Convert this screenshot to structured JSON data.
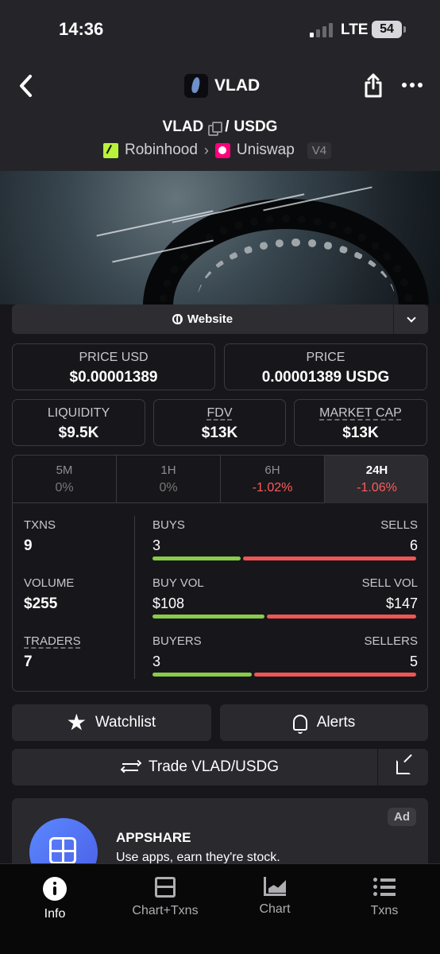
{
  "status_bar": {
    "time": "14:36",
    "network": "LTE",
    "battery": "54"
  },
  "header": {
    "token_name": "VLAD",
    "base": "VLAD",
    "separator": "/",
    "quote": "USDG",
    "chain": "Robinhood",
    "dex": "Uniswap",
    "version": "V4"
  },
  "website_button": "Website",
  "prices": [
    {
      "label": "PRICE USD",
      "value": "$0.00001389"
    },
    {
      "label": "PRICE",
      "value": "0.00001389 USDG"
    }
  ],
  "market_stats": [
    {
      "label": "LIQUIDITY",
      "value": "$9.5K"
    },
    {
      "label": "FDV",
      "value": "$13K"
    },
    {
      "label": "MARKET CAP",
      "value": "$13K"
    }
  ],
  "periods": [
    {
      "label": "5M",
      "value": "0%"
    },
    {
      "label": "1H",
      "value": "0%"
    },
    {
      "label": "6H",
      "value": "-1.02%"
    },
    {
      "label": "24H",
      "value": "-1.06%"
    }
  ],
  "metrics": {
    "txns_label": "TXNS",
    "txns_value": "9",
    "volume_label": "VOLUME",
    "volume_value": "$255",
    "traders_label": "TRADERS",
    "traders_value": "7",
    "buys_label": "BUYS",
    "sells_label": "SELLS",
    "buys_value": "3",
    "sells_value": "6",
    "buy_vol_label": "BUY VOL",
    "sell_vol_label": "SELL VOL",
    "buy_vol_value": "$108",
    "sell_vol_value": "$147",
    "buyers_label": "BUYERS",
    "sellers_label": "SELLERS",
    "buyers_value": "3",
    "sellers_value": "5"
  },
  "ratios": {
    "buys": 0.333,
    "buy_volume": 0.424,
    "buyers": 0.375
  },
  "actions": {
    "watchlist": "Watchlist",
    "alerts": "Alerts",
    "trade": "Trade VLAD/USDG"
  },
  "ad": {
    "tag": "Ad",
    "title": "APPSHARE",
    "description": "Use apps, earn they're stock."
  },
  "tabs": [
    "Info",
    "Chart+Txns",
    "Chart",
    "Txns"
  ],
  "colors": {
    "background": "#17171b",
    "header": "#252529",
    "buy": "#8acb4a",
    "sell": "#ef5555",
    "negative": "#ff5a5a",
    "ad_logo": "#5b88ff"
  }
}
